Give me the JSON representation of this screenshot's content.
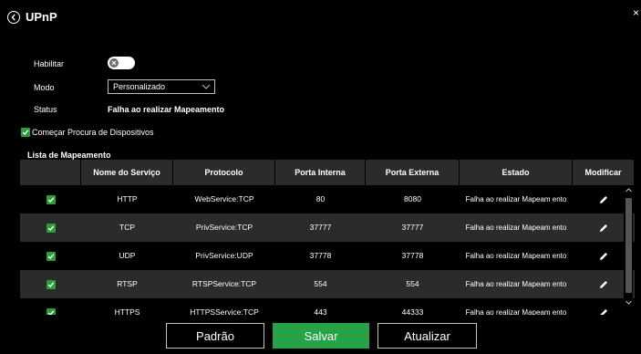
{
  "header": {
    "title": "UPnP",
    "close_label": "×"
  },
  "form": {
    "enable_label": "Habilitar",
    "enable_on": false,
    "mode_label": "Modo",
    "mode_value": "Personalizado",
    "status_label": "Status",
    "status_value": "Falha ao realizar Mapeamento",
    "discover_label": "Começar Procura de Dispositivos",
    "discover_checked": true
  },
  "mapping": {
    "title": "Lista de Mapeamento",
    "columns": [
      "",
      "Nome do Serviço",
      "Protocolo",
      "Porta Interna",
      "Porta Externa",
      "Estado",
      "Modificar"
    ],
    "rows": [
      {
        "checked": true,
        "name": "HTTP",
        "protocol": "WebService:TCP",
        "internal": "80",
        "external": "8080",
        "status": "Falha ao realizar Mapeam ento"
      },
      {
        "checked": true,
        "name": "TCP",
        "protocol": "PrivService:TCP",
        "internal": "37777",
        "external": "37777",
        "status": "Falha ao realizar Mapeam ento"
      },
      {
        "checked": true,
        "name": "UDP",
        "protocol": "PrivService:UDP",
        "internal": "37778",
        "external": "37778",
        "status": "Falha ao realizar Mapeam ento"
      },
      {
        "checked": true,
        "name": "RTSP",
        "protocol": "RTSPService:TCP",
        "internal": "554",
        "external": "554",
        "status": "Falha ao realizar Mapeam ento"
      },
      {
        "checked": true,
        "name": "HTTPS",
        "protocol": "HTTPSService:TCP",
        "internal": "443",
        "external": "44333",
        "status": "Falha ao realizar Mapeam ento"
      }
    ]
  },
  "footer": {
    "default_label": "Padrão",
    "save_label": "Salvar",
    "refresh_label": "Atualizar"
  },
  "colors": {
    "accent_green": "#27a347",
    "checkbox_green": "#2e9e3a",
    "row_alt": "#2b2b2b",
    "background": "#000000"
  }
}
